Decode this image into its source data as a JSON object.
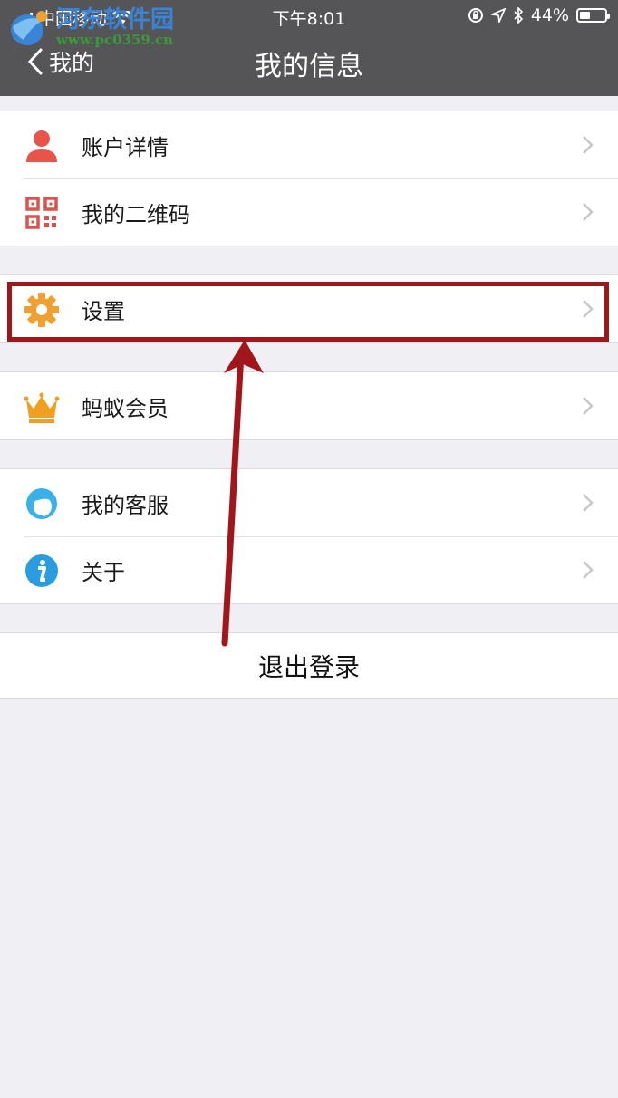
{
  "status_bar": {
    "carrier": "中国移动",
    "time": "下午8:01",
    "battery_percent": "44%",
    "battery_level": 0.44
  },
  "watermark": {
    "name": "河东软件园",
    "url": "www.pc0359.cn"
  },
  "nav": {
    "back_label": "我的",
    "title": "我的信息"
  },
  "groups": [
    {
      "items": [
        {
          "label": "账户详情",
          "icon": "person-icon"
        },
        {
          "label": "我的二维码",
          "icon": "qr-code-icon"
        }
      ]
    },
    {
      "items": [
        {
          "label": "设置",
          "icon": "gear-icon"
        }
      ]
    },
    {
      "items": [
        {
          "label": "蚂蚁会员",
          "icon": "crown-icon"
        }
      ]
    },
    {
      "items": [
        {
          "label": "我的客服",
          "icon": "customer-service-icon"
        },
        {
          "label": "关于",
          "icon": "info-icon"
        }
      ]
    }
  ],
  "logout_label": "退出登录",
  "colors": {
    "header_bg": "#555557",
    "page_bg": "#efeff4",
    "annotation_red": "#a0161a",
    "person_icon": "#e8534a",
    "qr_icon": "#d9534f",
    "gear_icon": "#f0a030",
    "crown_icon": "#f0a020",
    "service_icon": "#3ab0e8",
    "info_icon": "#2a9de0"
  }
}
